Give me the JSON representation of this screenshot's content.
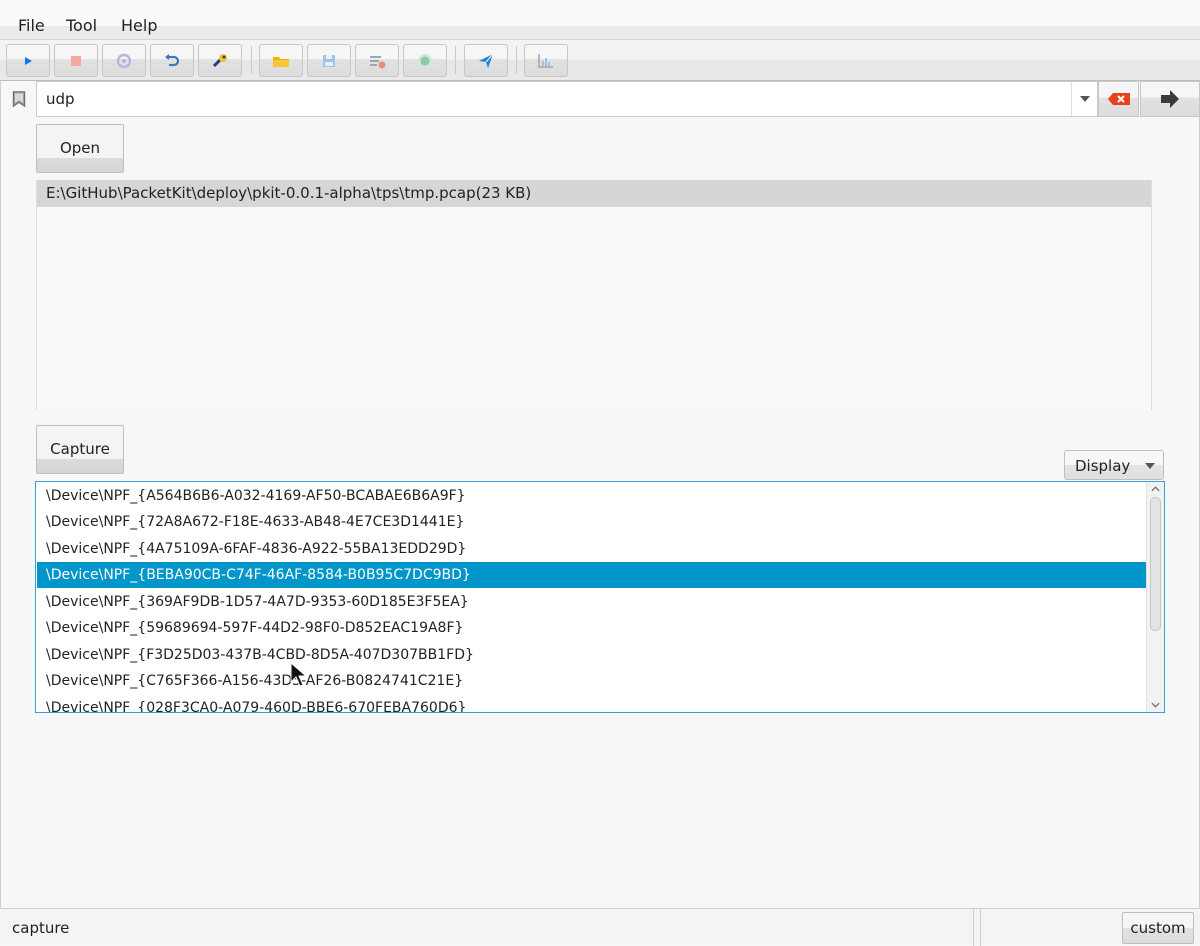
{
  "menu": {
    "file": "File",
    "tool": "Tool",
    "help": "Help"
  },
  "toolbar": {
    "buttons": [
      {
        "name": "start-capture",
        "icon": "play-icon"
      },
      {
        "name": "stop-capture",
        "icon": "stop-icon"
      },
      {
        "name": "restart-capture",
        "icon": "refresh-icon"
      },
      {
        "name": "undo",
        "icon": "undo-icon"
      },
      {
        "name": "settings",
        "icon": "wrench-icon"
      },
      {
        "name": "open-file",
        "icon": "folder-icon"
      },
      {
        "name": "save-file",
        "icon": "save-icon"
      },
      {
        "name": "clear",
        "icon": "clear-list-icon"
      },
      {
        "name": "record",
        "icon": "record-icon"
      },
      {
        "name": "send",
        "icon": "send-icon"
      },
      {
        "name": "statistics",
        "icon": "chart-icon"
      }
    ]
  },
  "filter": {
    "value": "udp"
  },
  "open_label": "Open",
  "recent_file": "E:\\GitHub\\PacketKit\\deploy\\pkit-0.0.1-alpha\\tps\\tmp.pcap(23 KB)",
  "capture_label": "Capture",
  "display_label": "Display",
  "devices": [
    "\\Device\\NPF_{A564B6B6-A032-4169-AF50-BCABAE6B6A9F}",
    "\\Device\\NPF_{72A8A672-F18E-4633-AB48-4E7CE3D1441E}",
    "\\Device\\NPF_{4A75109A-6FAF-4836-A922-55BA13EDD29D}",
    "\\Device\\NPF_{BEBA90CB-C74F-46AF-8584-B0B95C7DC9BD}",
    "\\Device\\NPF_{369AF9DB-1D57-4A7D-9353-60D185E3F5EA}",
    "\\Device\\NPF_{59689694-597F-44D2-98F0-D852EAC19A8F}",
    "\\Device\\NPF_{F3D25D03-437B-4CBD-8D5A-407D307BB1FD}",
    "\\Device\\NPF_{C765F366-A156-43D5-AF26-B0824741C21E}",
    "\\Device\\NPF_{028F3CA0-A079-460D-BBE6-670FEBA760D6}"
  ],
  "selected_device_index": 3,
  "status": {
    "text": "capture",
    "custom_label": "custom"
  },
  "colors": {
    "selection": "#0096c9",
    "focus_border": "#3a9fd2",
    "clear_filter": "#e8401c"
  }
}
